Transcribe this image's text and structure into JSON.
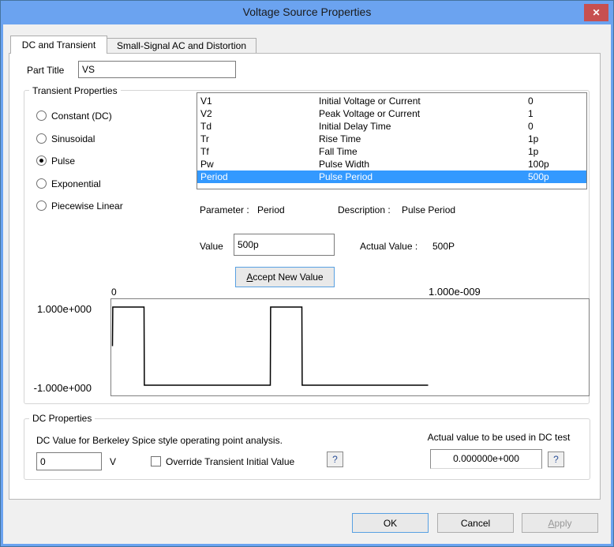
{
  "window": {
    "title": "Voltage Source Properties",
    "close_glyph": "✕"
  },
  "colors": {
    "titlebar": "#6ba3f0",
    "close_button": "#c75050",
    "selection": "#3399ff",
    "focus_border": "#58a0e2"
  },
  "tabs": [
    {
      "label": "DC and Transient",
      "active": true
    },
    {
      "label": "Small-Signal AC and Distortion",
      "active": false
    }
  ],
  "part_title": {
    "label": "Part Title",
    "value": "VS"
  },
  "transient": {
    "group_label": "Transient Properties",
    "signal_types": [
      {
        "label": "Constant (DC)",
        "selected": false
      },
      {
        "label": "Sinusoidal",
        "selected": false
      },
      {
        "label": "Pulse",
        "selected": true
      },
      {
        "label": "Exponential",
        "selected": false
      },
      {
        "label": "Piecewise Linear",
        "selected": false
      }
    ],
    "parameters": [
      {
        "name": "V1",
        "description": "Initial Voltage or Current",
        "value": "0",
        "selected": false
      },
      {
        "name": "V2",
        "description": "Peak Voltage or Current",
        "value": "1",
        "selected": false
      },
      {
        "name": "Td",
        "description": "Initial Delay Time",
        "value": "0",
        "selected": false
      },
      {
        "name": "Tr",
        "description": "Rise Time",
        "value": "1p",
        "selected": false
      },
      {
        "name": "Tf",
        "description": "Fall Time",
        "value": "1p",
        "selected": false
      },
      {
        "name": "Pw",
        "description": "Pulse Width",
        "value": "100p",
        "selected": false
      },
      {
        "name": "Period",
        "description": "Pulse Period",
        "value": "500p",
        "selected": true
      }
    ],
    "parameter_label": "Parameter :",
    "parameter_value": "Period",
    "description_label": "Description :",
    "description_value": "Pulse Period",
    "value_label": "Value",
    "value_input": "500p",
    "actual_value_label": "Actual Value :",
    "actual_value": "500P",
    "accept_button_label": "Accept New Value"
  },
  "chart_data": {
    "type": "line",
    "title": "Pulse waveform preview",
    "x_tick_labels": [
      "0",
      "1.000e-009"
    ],
    "y_tick_labels": [
      "1.000e+000",
      "-1.000e+000"
    ],
    "points_t_ps_v": [
      [
        0,
        0
      ],
      [
        1,
        1
      ],
      [
        100,
        1
      ],
      [
        101,
        -1
      ],
      [
        500,
        -1
      ],
      [
        501,
        1
      ],
      [
        600,
        1
      ],
      [
        601,
        -1
      ],
      [
        1000,
        -1
      ]
    ],
    "ylim": [
      -1,
      1
    ],
    "xlim_ps": [
      0,
      1500
    ],
    "grid": false,
    "legend": false
  },
  "dc": {
    "group_label": "DC Properties",
    "description": "DC Value for Berkeley Spice style operating point analysis.",
    "value": "0",
    "unit": "V",
    "override_label": "Override Transient Initial Value",
    "override_checked": false,
    "help_label": "?",
    "actual_label": "Actual value to be used in DC test",
    "actual_value": "0.000000e+000"
  },
  "buttons": {
    "ok": "OK",
    "cancel": "Cancel",
    "apply": "Apply",
    "apply_enabled": false
  }
}
